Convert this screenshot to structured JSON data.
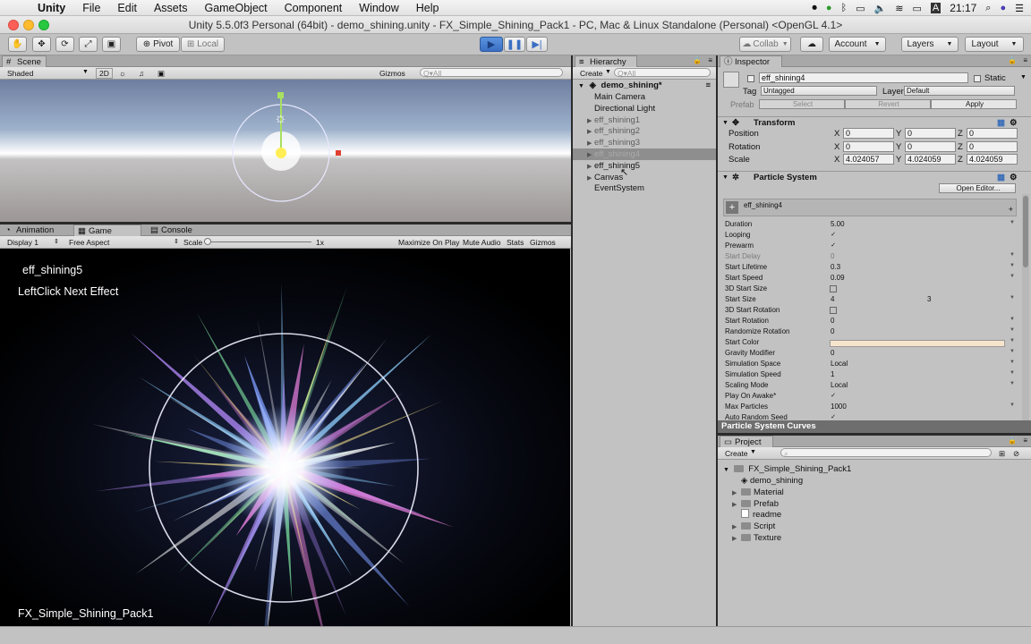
{
  "menubar": {
    "app": "Unity",
    "items": [
      "File",
      "Edit",
      "Assets",
      "GameObject",
      "Component",
      "Window",
      "Help"
    ],
    "clock": "21:17"
  },
  "window": {
    "title": "Unity 5.5.0f3 Personal (64bit) - demo_shining.unity - FX_Simple_Shining_Pack1 - PC, Mac & Linux Standalone (Personal) <OpenGL 4.1>"
  },
  "toolbar": {
    "pivot": "Pivot",
    "local": "Local",
    "collab": "Collab",
    "account": "Account",
    "layers": "Layers",
    "layout": "Layout"
  },
  "scene": {
    "tab": "Scene",
    "shading": "Shaded",
    "mode_2d": "2D",
    "gizmos": "Gizmos",
    "search_placeholder": "Q▾All"
  },
  "game": {
    "tabs": [
      "Animation",
      "Game",
      "Console"
    ],
    "display": "Display 1",
    "aspect": "Free Aspect",
    "scale_label": "Scale",
    "scale_value": "1x",
    "scale_level": 0.0,
    "options": [
      "Maximize On Play",
      "Mute Audio",
      "Stats",
      "Gizmos"
    ],
    "overlay_effect": "eff_shining5",
    "overlay_hint": "LeftClick Next Effect",
    "overlay_pack": "FX_Simple_Shining_Pack1"
  },
  "hierarchy": {
    "tab": "Hierarchy",
    "create": "Create",
    "search_placeholder": "Q▾All",
    "scene_name": "demo_shining*",
    "items": [
      {
        "label": "Main Camera",
        "dim": false,
        "sel": false,
        "arrow": false
      },
      {
        "label": "Directional Light",
        "dim": false,
        "sel": false,
        "arrow": false
      },
      {
        "label": "eff_shining1",
        "dim": true,
        "sel": false,
        "arrow": true
      },
      {
        "label": "eff_shining2",
        "dim": true,
        "sel": false,
        "arrow": true
      },
      {
        "label": "eff_shining3",
        "dim": true,
        "sel": false,
        "arrow": true
      },
      {
        "label": "eff_shining4",
        "dim": true,
        "sel": true,
        "arrow": true
      },
      {
        "label": "eff_shining5",
        "dim": false,
        "sel": false,
        "arrow": true
      },
      {
        "label": "Canvas",
        "dim": false,
        "sel": false,
        "arrow": true
      },
      {
        "label": "EventSystem",
        "dim": false,
        "sel": false,
        "arrow": false
      }
    ]
  },
  "inspector": {
    "tab": "Inspector",
    "object_name": "eff_shining4",
    "static": "Static",
    "tag_label": "Tag",
    "tag_value": "Untagged",
    "layer_label": "Layer",
    "layer_value": "Default",
    "prefab_label": "Prefab",
    "prefab_select": "Select",
    "prefab_revert": "Revert",
    "prefab_apply": "Apply",
    "transform_title": "Transform",
    "transform_rows": [
      {
        "label": "Position",
        "x": "0",
        "y": "0",
        "z": "0"
      },
      {
        "label": "Rotation",
        "x": "0",
        "y": "0",
        "z": "0"
      },
      {
        "label": "Scale",
        "x": "4.024057",
        "y": "4.024059",
        "z": "4.024059"
      }
    ],
    "particle_title": "Particle System",
    "open_editor": "Open Editor...",
    "particle_name": "eff_shining4",
    "particle_rows": [
      {
        "label": "Duration",
        "value": "5.00",
        "type": "text",
        "dim": false
      },
      {
        "label": "Looping",
        "value": "✓",
        "type": "check",
        "dim": false
      },
      {
        "label": "Prewarm",
        "value": "✓",
        "type": "check",
        "dim": false
      },
      {
        "label": "Start Delay",
        "value": "0",
        "type": "text",
        "dim": true
      },
      {
        "label": "Start Lifetime",
        "value": "0.3",
        "type": "text",
        "dim": false
      },
      {
        "label": "Start Speed",
        "value": "0.09",
        "type": "text",
        "dim": false
      },
      {
        "label": "3D Start Size",
        "value": "",
        "type": "check",
        "dim": false
      },
      {
        "label": "Start Size",
        "value": "4",
        "value2": "3",
        "type": "two",
        "dim": false
      },
      {
        "label": "3D Start Rotation",
        "value": "",
        "type": "check",
        "dim": false
      },
      {
        "label": "Start Rotation",
        "value": "0",
        "type": "text",
        "dim": false
      },
      {
        "label": "Randomize Rotation",
        "value": "0",
        "type": "text",
        "dim": false
      },
      {
        "label": "Start Color",
        "value": "",
        "type": "color",
        "dim": false
      },
      {
        "label": "Gravity Modifier",
        "value": "0",
        "type": "text",
        "dim": false
      },
      {
        "label": "Simulation Space",
        "value": "Local",
        "type": "text",
        "dim": false
      },
      {
        "label": "Simulation Speed",
        "value": "1",
        "type": "text",
        "dim": false
      },
      {
        "label": "Scaling Mode",
        "value": "Local",
        "type": "text",
        "dim": false
      },
      {
        "label": "Play On Awake*",
        "value": "✓",
        "type": "check",
        "dim": false
      },
      {
        "label": "Max Particles",
        "value": "1000",
        "type": "text",
        "dim": false
      },
      {
        "label": "Auto Random Seed",
        "value": "✓",
        "type": "check",
        "dim": false
      }
    ],
    "curves_label": "Particle System Curves"
  },
  "project": {
    "tab": "Project",
    "create": "Create",
    "root": "FX_Simple_Shining_Pack1",
    "items": [
      {
        "label": "demo_shining",
        "kind": "unity"
      },
      {
        "label": "Material",
        "kind": "folder"
      },
      {
        "label": "Prefab",
        "kind": "folder"
      },
      {
        "label": "readme",
        "kind": "file"
      },
      {
        "label": "Script",
        "kind": "folder"
      },
      {
        "label": "Texture",
        "kind": "folder"
      }
    ]
  },
  "colors": {
    "start_color": "#f7e4cc",
    "accent_play": "#3b7bd6",
    "panel_bg": "#c2c2c2"
  }
}
